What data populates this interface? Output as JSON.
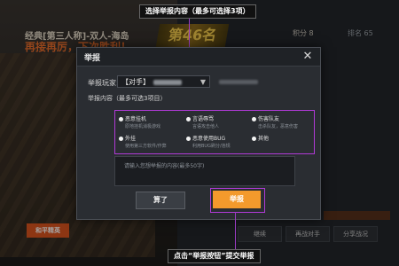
{
  "annotations": {
    "top": "选择举报内容（最多可选择3项）",
    "bottom": "点击“举报按钮”提交举报"
  },
  "background": {
    "mode_title": "经典[第三人称]-双人-海岛",
    "slogan": "再接再厉，下次胜利！",
    "rank": "第46名",
    "score_label": "积分",
    "score_value": "8",
    "stat_label": "排名",
    "stat_value": "65",
    "logo": "和平精英",
    "bottom_buttons": [
      "继续",
      "再战对手",
      "分享战况"
    ]
  },
  "dialog": {
    "title": "举报",
    "close_icon": "close-icon",
    "player_label": "举报玩家:",
    "player_prefix": "【对手】",
    "content_label": "举报内容（最多可选3项目）",
    "reasons": [
      {
        "label": "恶意挂机",
        "desc": "原地挂机消极游戏"
      },
      {
        "label": "言语辱骂",
        "desc": "言语攻击他人"
      },
      {
        "label": "伤害队友",
        "desc": "击杀队友，恶意伤害"
      },
      {
        "label": "外挂",
        "desc": "使用第三方软件/作弊"
      },
      {
        "label": "恶意使用BUG",
        "desc": "利用BUG刷分/违规"
      },
      {
        "label": "其他",
        "desc": ""
      }
    ],
    "textarea_placeholder": "请输入您想举报的内容(最多50字)",
    "cancel_label": "算了",
    "submit_label": "举报"
  },
  "colors": {
    "accent_purple": "#b03ad6",
    "submit_orange": "#f39a2c"
  }
}
